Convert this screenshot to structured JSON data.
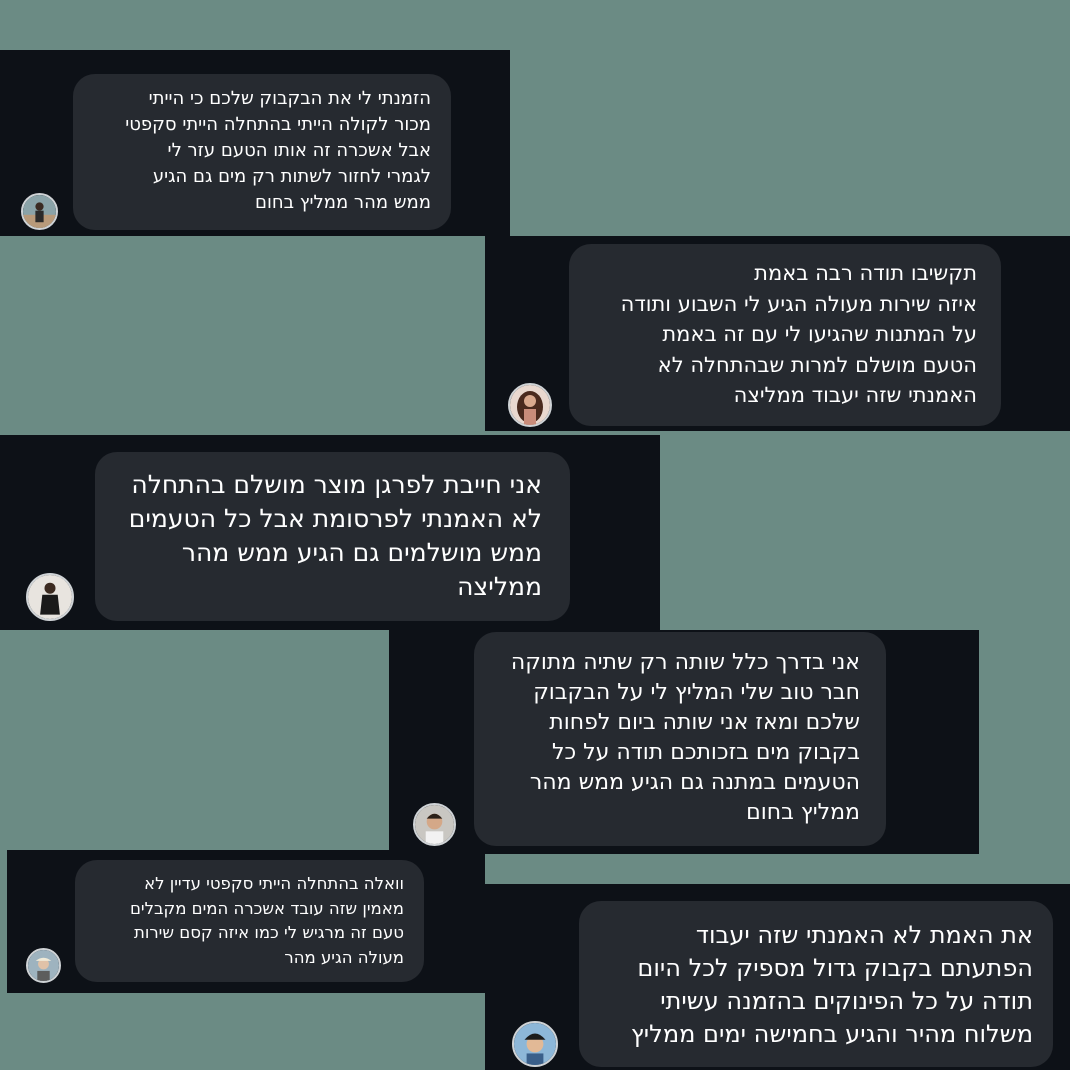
{
  "messages": [
    {
      "lines": [
        "הזמנתי לי את הבקבוק שלכם כי הייתי",
        "מכור לקולה הייתי בהתחלה הייתי סקפטי",
        "אבל אשכרה זה אותו הטעם עזר לי",
        "לגמרי לחזור לשתות רק מים גם הגיע",
        "ממש מהר ממליץ בחום"
      ]
    },
    {
      "lines": [
        "תקשיבו תודה רבה באמת",
        "איזה שירות מעולה הגיע לי השבוע ותודה",
        "על המתנות שהגיעו לי עם זה באמת",
        "הטעם מושלם למרות שבהתחלה לא",
        "האמנתי שזה יעבוד ממליצה"
      ]
    },
    {
      "lines": [
        "אני חייבת לפרגן מוצר מושלם בהתחלה",
        "לא האמנתי לפרסומת אבל כל הטעמים",
        "ממש מושלמים גם הגיע ממש מהר",
        "ממליצה"
      ]
    },
    {
      "lines": [
        "אני בדרך כלל שותה רק שתיה מתוקה",
        "חבר טוב שלי המליץ לי על הבקבוק",
        "שלכם ומאז אני שותה ביום לפחות",
        "בקבוק מים בזכותכם תודה על כל",
        "הטעמים במתנה גם הגיע ממש מהר",
        "ממליץ בחום"
      ]
    },
    {
      "lines": [
        "וואלה בהתחלה הייתי סקפטי עדיין לא",
        "מאמין שזה עובד אשכרה המים מקבלים",
        "טעם זה מרגיש לי כמו איזה קסם שירות",
        "מעולה הגיע מהר"
      ]
    },
    {
      "lines": [
        "את האמת לא האמנתי שזה יעבוד",
        "הפתעתם בקבוק גדול מספיק לכל היום",
        "תודה על כל הפינוקים בהזמנה עשיתי",
        "משלוח מהיר והגיע בחמישה ימים ממליץ"
      ]
    }
  ],
  "colors": {
    "background": "#6b8b84",
    "card": "#0d1117",
    "bubble": "#262a30",
    "text": "#ffffff"
  }
}
